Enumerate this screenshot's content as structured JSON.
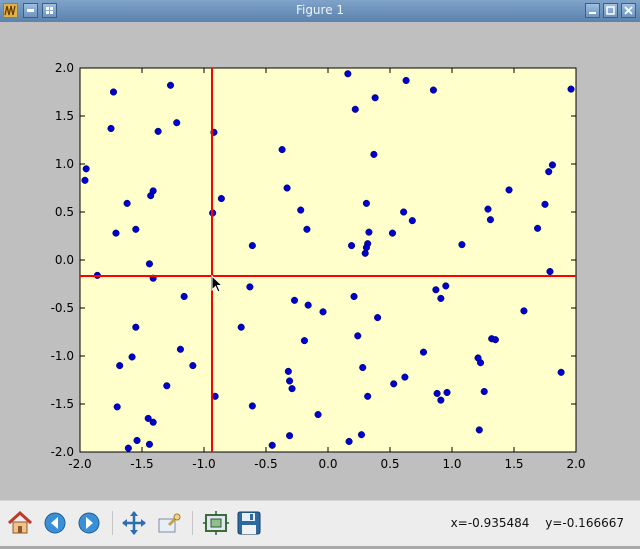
{
  "window": {
    "title": "Figure 1"
  },
  "icons": {
    "app": "matplotlib-wave-icon",
    "menu": "window-menu-icon",
    "pin": "pin-grid-icon",
    "minimize": "minimize-icon",
    "maximize": "maximize-icon",
    "close": "close-icon"
  },
  "toolbar": {
    "tools": [
      "home-icon",
      "back-arrow-icon",
      "forward-arrow-icon",
      "pan-move-icon",
      "zoom-rect-icon",
      "subplots-config-icon",
      "save-floppy-icon"
    ],
    "coords": {
      "x": "x=-0.935484",
      "y": "y=-0.166667"
    }
  },
  "colors": {
    "axes_bg": "#ffffcc",
    "marker": "#0000cc",
    "cursor_line": "#ff0000",
    "figure_bg": "#bfbfbf"
  },
  "chart_data": {
    "type": "scatter",
    "xlim": [
      -2.0,
      2.0
    ],
    "ylim": [
      -2.0,
      2.0
    ],
    "xticks": [
      "-2.0",
      "-1.5",
      "-1.0",
      "-0.5",
      "0.0",
      "0.5",
      "1.0",
      "1.5",
      "2.0"
    ],
    "yticks": [
      "2.0",
      "1.5",
      "1.0",
      "0.5",
      "0.0",
      "-0.5",
      "-1.0",
      "-1.5",
      "-2.0"
    ],
    "xtick_values": [
      -2.0,
      -1.5,
      -1.0,
      -0.5,
      0.0,
      0.5,
      1.0,
      1.5,
      2.0
    ],
    "ytick_values": [
      2.0,
      1.5,
      1.0,
      0.5,
      0.0,
      -0.5,
      -1.0,
      -1.5,
      -2.0
    ],
    "crosshair": {
      "x": -0.935484,
      "y": -0.166667
    },
    "grid": false,
    "points": [
      [
        -1.95,
        0.95
      ],
      [
        -1.96,
        0.83
      ],
      [
        -1.86,
        -0.16
      ],
      [
        -1.73,
        1.75
      ],
      [
        -1.75,
        1.37
      ],
      [
        -1.71,
        0.28
      ],
      [
        -1.62,
        0.59
      ],
      [
        -1.55,
        0.32
      ],
      [
        -1.43,
        0.67
      ],
      [
        -1.41,
        0.72
      ],
      [
        -1.37,
        1.34
      ],
      [
        -1.27,
        1.82
      ],
      [
        -1.22,
        1.43
      ],
      [
        -1.44,
        -0.04
      ],
      [
        -1.41,
        -0.19
      ],
      [
        -1.16,
        -0.38
      ],
      [
        -1.55,
        -0.7
      ],
      [
        -1.58,
        -1.01
      ],
      [
        -1.68,
        -1.1
      ],
      [
        -1.7,
        -1.53
      ],
      [
        -1.61,
        -1.96
      ],
      [
        -1.54,
        -1.88
      ],
      [
        -1.44,
        -1.92
      ],
      [
        -1.45,
        -1.65
      ],
      [
        -1.41,
        -1.69
      ],
      [
        -1.3,
        -1.31
      ],
      [
        -1.19,
        -0.93
      ],
      [
        -1.09,
        -1.1
      ],
      [
        -0.92,
        1.33
      ],
      [
        -0.93,
        0.49
      ],
      [
        -0.86,
        0.64
      ],
      [
        -0.91,
        -1.42
      ],
      [
        -0.7,
        -0.7
      ],
      [
        -0.61,
        0.15
      ],
      [
        -0.63,
        -0.28
      ],
      [
        -0.61,
        -1.52
      ],
      [
        -0.45,
        -1.93
      ],
      [
        -0.37,
        1.15
      ],
      [
        -0.33,
        0.75
      ],
      [
        -0.22,
        0.52
      ],
      [
        -0.17,
        0.32
      ],
      [
        -0.27,
        -0.42
      ],
      [
        -0.16,
        -0.47
      ],
      [
        -0.04,
        -0.54
      ],
      [
        -0.19,
        -0.84
      ],
      [
        -0.32,
        -1.16
      ],
      [
        -0.31,
        -1.26
      ],
      [
        -0.29,
        -1.34
      ],
      [
        -0.31,
        -1.83
      ],
      [
        -0.08,
        -1.61
      ],
      [
        0.16,
        1.94
      ],
      [
        0.22,
        1.57
      ],
      [
        0.38,
        1.69
      ],
      [
        0.37,
        1.1
      ],
      [
        0.31,
        0.59
      ],
      [
        0.33,
        0.29
      ],
      [
        0.32,
        0.17
      ],
      [
        0.31,
        0.13
      ],
      [
        0.3,
        0.07
      ],
      [
        0.19,
        0.15
      ],
      [
        0.21,
        -0.38
      ],
      [
        0.24,
        -0.79
      ],
      [
        0.28,
        -1.12
      ],
      [
        0.32,
        -1.42
      ],
      [
        0.27,
        -1.82
      ],
      [
        0.17,
        -1.89
      ],
      [
        0.4,
        -0.6
      ],
      [
        0.52,
        0.28
      ],
      [
        0.61,
        0.5
      ],
      [
        0.68,
        0.41
      ],
      [
        0.63,
        1.87
      ],
      [
        0.85,
        1.77
      ],
      [
        0.77,
        -0.96
      ],
      [
        0.62,
        -1.22
      ],
      [
        0.53,
        -1.29
      ],
      [
        0.87,
        -0.31
      ],
      [
        0.91,
        -0.4
      ],
      [
        0.95,
        -0.27
      ],
      [
        0.88,
        -1.39
      ],
      [
        0.91,
        -1.46
      ],
      [
        0.96,
        -1.38
      ],
      [
        1.08,
        0.16
      ],
      [
        1.21,
        -1.02
      ],
      [
        1.23,
        -1.07
      ],
      [
        1.26,
        -1.37
      ],
      [
        1.22,
        -1.77
      ],
      [
        1.32,
        -0.82
      ],
      [
        1.35,
        -0.83
      ],
      [
        1.29,
        0.53
      ],
      [
        1.31,
        0.42
      ],
      [
        1.46,
        0.73
      ],
      [
        1.58,
        -0.53
      ],
      [
        1.69,
        0.33
      ],
      [
        1.75,
        0.58
      ],
      [
        1.78,
        0.92
      ],
      [
        1.81,
        0.99
      ],
      [
        1.79,
        -0.12
      ],
      [
        1.88,
        -1.17
      ],
      [
        1.96,
        1.78
      ]
    ]
  }
}
